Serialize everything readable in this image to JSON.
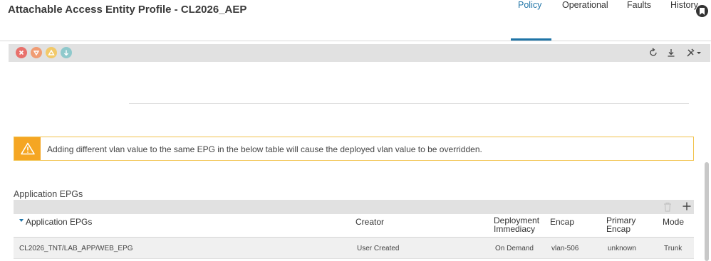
{
  "header": {
    "title": "Attachable Access Entity Profile - CL2026_AEP"
  },
  "tabs": [
    {
      "label": "Policy",
      "active": true
    },
    {
      "label": "Operational",
      "active": false
    },
    {
      "label": "Faults",
      "active": false
    },
    {
      "label": "History",
      "active": false
    }
  ],
  "toolbar": {
    "fault_icons": [
      {
        "name": "critical-fault-icon",
        "color": "#e8716c"
      },
      {
        "name": "major-fault-icon",
        "color": "#f09c73"
      },
      {
        "name": "minor-fault-icon",
        "color": "#f2c969"
      },
      {
        "name": "warning-fault-icon",
        "color": "#8fc9cc"
      }
    ],
    "actions": [
      "refresh-icon",
      "download-icon",
      "tools-icon"
    ]
  },
  "warning": {
    "text": "Adding different vlan value to the same EPG in the below table will cause the deployed vlan value to be overridden.",
    "color": "#f5a623"
  },
  "section": {
    "title": "Application EPGs"
  },
  "table": {
    "columns": {
      "epg": "Application EPGs",
      "creator": "Creator",
      "deploy_1": "Deployment",
      "deploy_2": "Immediacy",
      "encap": "Encap",
      "primary_1": "Primary",
      "primary_2": "Encap",
      "mode": "Mode"
    },
    "rows": [
      {
        "epg": "CL2026_TNT/LAB_APP/WEB_EPG",
        "creator": "User Created",
        "deploy": "On Demand",
        "encap": "vlan-506",
        "primary": "unknown",
        "mode": "Trunk"
      }
    ]
  }
}
